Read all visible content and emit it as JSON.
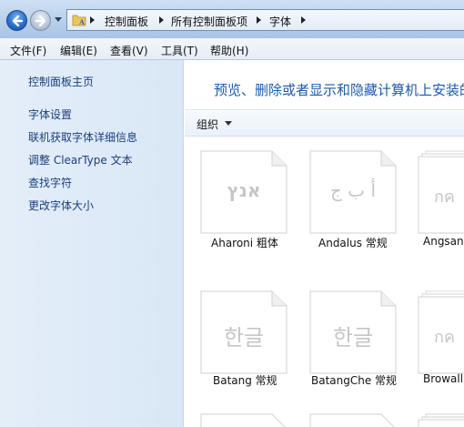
{
  "address_bar": {
    "crumbs": [
      "控制面板",
      "所有控制面板项",
      "字体"
    ]
  },
  "menu": {
    "items": [
      "文件(F)",
      "编辑(E)",
      "查看(V)",
      "工具(T)",
      "帮助(H)"
    ]
  },
  "sidebar": {
    "home": "控制面板主页",
    "links": [
      "字体设置",
      "联机获取字体详细信息",
      "调整 ClearType 文本",
      "查找字符",
      "更改字体大小"
    ]
  },
  "main": {
    "heading": "预览、删除或者显示和隐藏计算机上安装的字体",
    "toolbar": {
      "organize": "组织"
    },
    "fonts": [
      {
        "name": "Aharoni 粗体",
        "preview": "אנץ"
      },
      {
        "name": "Andalus 常规",
        "preview": "أ ب ﺝ"
      },
      {
        "name": "Angsana",
        "preview": "กค"
      },
      {
        "name": "Batang 常规",
        "preview": "한글"
      },
      {
        "name": "BatangChe 常规",
        "preview": "한글"
      },
      {
        "name": "Browalli",
        "preview": "กค"
      }
    ]
  },
  "colors": {
    "heading": "#1e5aa8",
    "sidebar_link": "#1a3f7a",
    "sidebar_bg": "#dde9f7"
  }
}
